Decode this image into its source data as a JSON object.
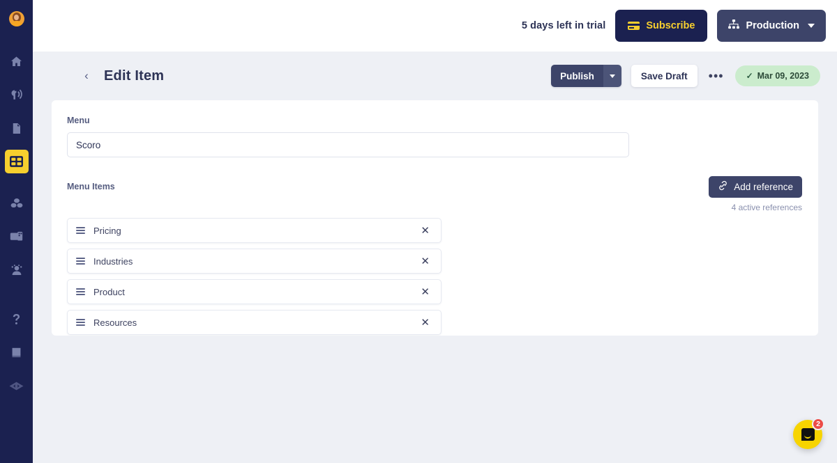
{
  "sidebar": {
    "avatar_name": "user-avatar",
    "items": [
      {
        "name": "home-icon",
        "label": "Home",
        "active": false
      },
      {
        "name": "broadcast-icon",
        "label": "Broadcast",
        "active": false
      },
      {
        "name": "document-icon",
        "label": "Content",
        "active": false
      },
      {
        "name": "grid-icon",
        "label": "Models",
        "active": true
      },
      {
        "name": "blocks-icon",
        "label": "Blocks",
        "active": false
      },
      {
        "name": "media-icon",
        "label": "Media",
        "active": false
      },
      {
        "name": "users-icon",
        "label": "Users",
        "active": false
      },
      {
        "name": "help-icon",
        "label": "Help",
        "active": false
      },
      {
        "name": "book-icon",
        "label": "Docs",
        "active": false
      },
      {
        "name": "code-icon",
        "label": "API",
        "active": false
      }
    ]
  },
  "topbar": {
    "trial_text": "5 days left in trial",
    "subscribe_label": "Subscribe",
    "environment_label": "Production"
  },
  "pagehead": {
    "back_label": "‹",
    "title": "Edit Item",
    "publish_label": "Publish",
    "save_draft_label": "Save Draft",
    "more_label": "•••",
    "status_check": "✓",
    "status_date": "Mar 09, 2023"
  },
  "form": {
    "menu_label": "Menu",
    "menu_value": "Scoro",
    "menu_placeholder": "",
    "menu_items_label": "Menu Items",
    "add_reference_label": "Add reference",
    "active_references": "4 active references",
    "items": [
      {
        "label": "Pricing",
        "remove": "✕"
      },
      {
        "label": "Industries",
        "remove": "✕"
      },
      {
        "label": "Product",
        "remove": "✕"
      },
      {
        "label": "Resources",
        "remove": "✕"
      }
    ]
  },
  "intercom": {
    "badge_count": "2"
  },
  "colors": {
    "sidebar_bg": "#1b2150",
    "accent_yellow": "#f7cf2e",
    "button_navy": "#3d4469",
    "page_bg": "#eef0f5",
    "status_green_bg": "#cbeccd",
    "badge_red": "#ec4c47"
  }
}
